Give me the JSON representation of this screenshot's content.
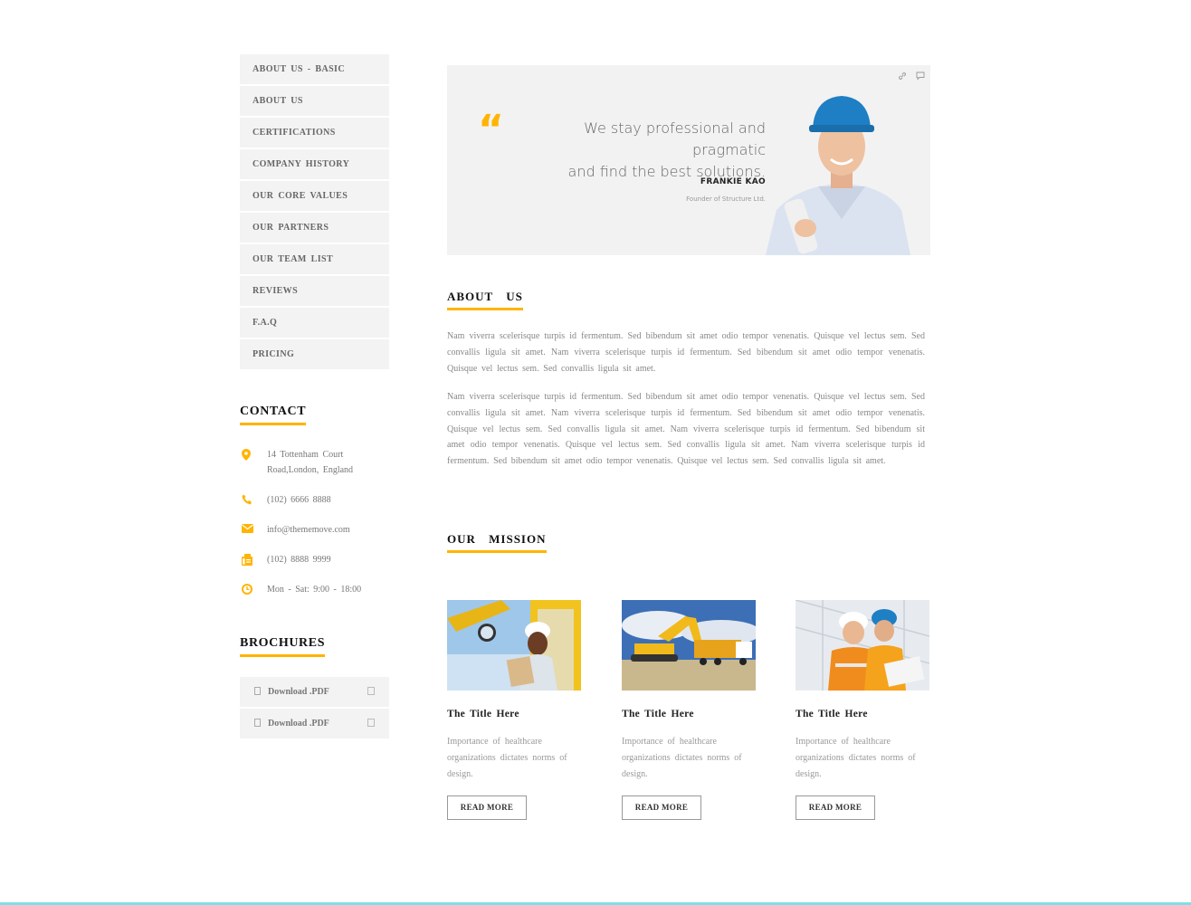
{
  "sidebar": {
    "nav_items": [
      "ABOUT  US  - BASIC",
      "ABOUT  US",
      "CERTIFICATIONS",
      "COMPANY  HISTORY",
      "OUR  CORE  VALUES",
      "OUR  PARTNERS",
      "OUR  TEAM  LIST",
      "REVIEWS",
      "F.A.Q",
      "PRICING"
    ]
  },
  "contact": {
    "title": "CONTACT",
    "address_line1": "14  Tottenham  Court",
    "address_line2": "Road,London,  England",
    "phone": "(102)  6666  8888",
    "email": "info@thememove.com",
    "fax": "(102)  8888  9999",
    "hours": "Mon  - Sat: 9:00  - 18:00"
  },
  "brochures": {
    "title": "BROCHURES",
    "items": [
      "Download  .PDF",
      "Download  .PDF"
    ]
  },
  "hero": {
    "quote_line1": "We stay professional and pragmatic",
    "quote_line2": "and find the best solutions.",
    "author": "FRANKIE KAO",
    "role": "Founder of Structure Ltd."
  },
  "about": {
    "title": "ABOUT  US",
    "paragraph1": "Nam  viverra  scelerisque   turpis  id fermentum.   Sed bibendum   sit amet  odio tempor  venenatis.   Quisque   vel lectus  sem.  Sed convallis  ligula sit amet.  Nam  viverra  scelerisque   turpis  id fermentum.   Sed bibendum   sit amet  odio  tempor venenatis.   Quisque   vel lectus  sem.  Sed convallis  ligula sit amet.",
    "paragraph2": "Nam  viverra  scelerisque   turpis  id fermentum.   Sed bibendum   sit amet  odio tempor  venenatis.   Quisque   vel lectus  sem.  Sed convallis  ligula sit amet.  Nam  viverra  scelerisque   turpis  id fermentum.   Sed bibendum   sit amet  odio  tempor venenatis.   Quisque   vel lectus  sem.  Sed convallis  ligula sit amet.  Nam  viverra  scelerisque   turpis  id fermentum.   Sed bibendum   sit amet  odio  tempor   venenatis.   Quisque   vel lectus  sem.  Sed convallis  ligula sit amet.  Nam  viverra  scelerisque   turpis  id fermentum.   Sed bibendum   sit amet  odio tempor  venenatis.   Quisque   vel lectus  sem.  Sed convallis  ligula sit amet."
  },
  "mission": {
    "title": "OUR  MISSION",
    "cards": [
      {
        "title": "The  Title  Here",
        "desc": "Importance   of healthcare organizations   dictates   norms  of design.",
        "button": "READ  MORE"
      },
      {
        "title": "The  Title  Here",
        "desc": "Importance   of healthcare organizations   dictates   norms  of design.",
        "button": "READ  MORE"
      },
      {
        "title": "The  Title  Here",
        "desc": "Importance   of healthcare organizations   dictates   norms  of design.",
        "button": "READ  MORE"
      }
    ]
  },
  "colors": {
    "accent": "#ffb400",
    "sidebar_bg": "#f3f3f3",
    "bottom_line": "#7ce0e6"
  },
  "icons": {
    "address": "map-pin-icon",
    "phone": "phone-icon",
    "email": "envelope-icon",
    "fax": "fax-icon",
    "hours": "clock-icon",
    "hero_link": "link-icon",
    "hero_comment": "comment-icon",
    "brochure_file": "file-icon",
    "brochure_download": "download-icon"
  }
}
